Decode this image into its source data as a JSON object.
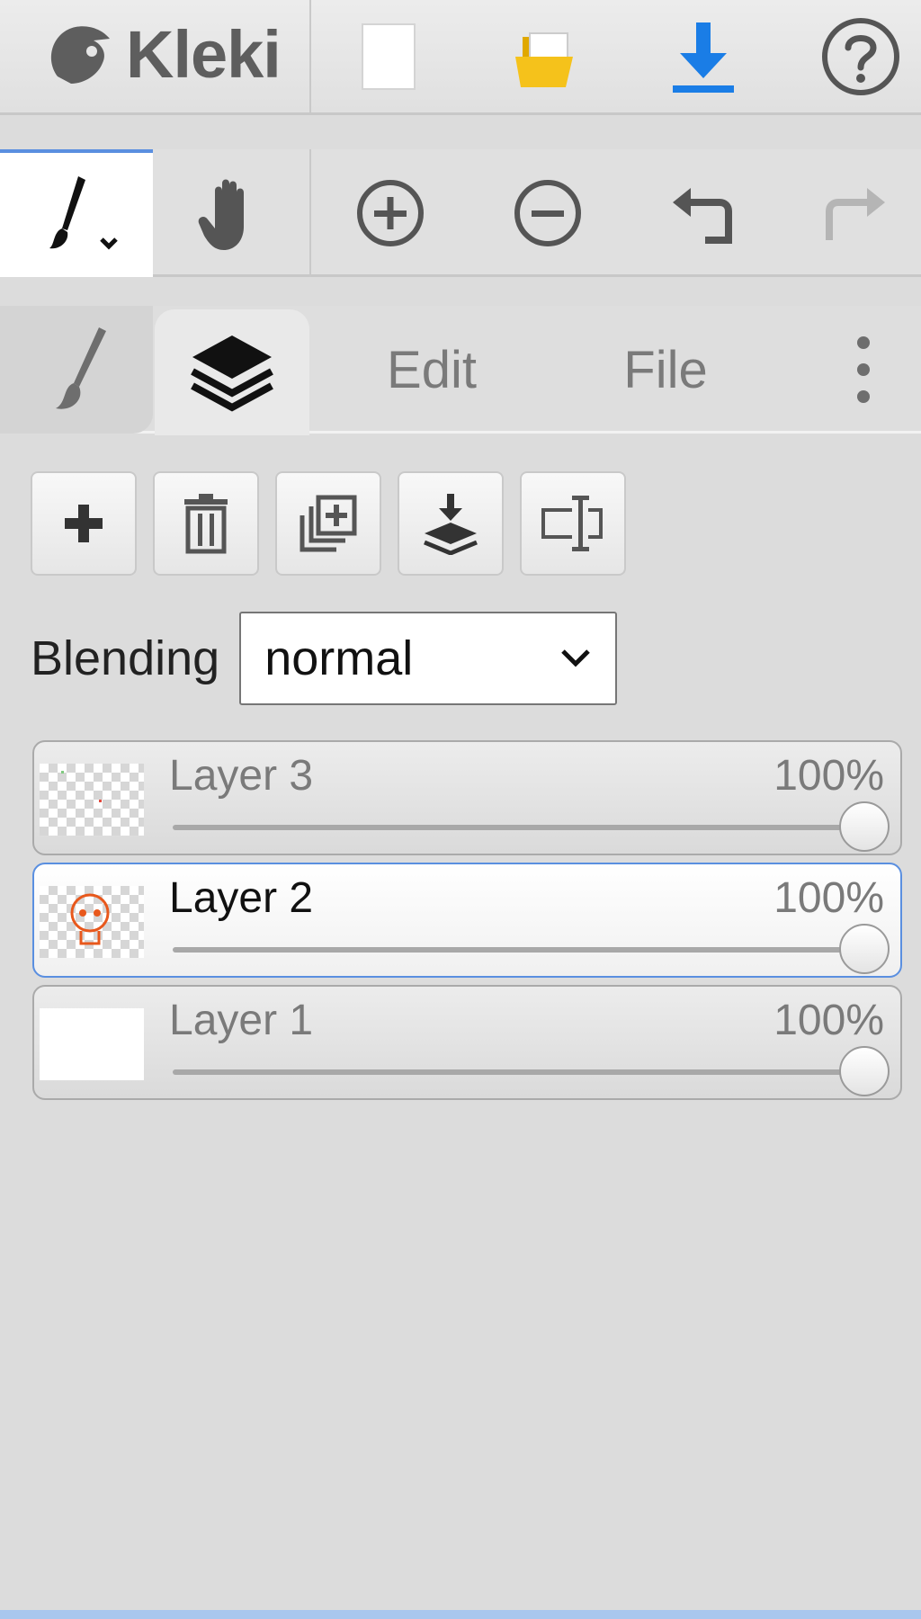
{
  "app": {
    "logo_text": "Kleki"
  },
  "topbar": {
    "new_icon": "new-document-icon",
    "open_icon": "open-folder-icon",
    "save_icon": "download-icon",
    "help_icon": "help-icon"
  },
  "tools": {
    "brush_icon": "brush-icon",
    "hand_icon": "hand-icon",
    "zoom_in_icon": "zoom-in-icon",
    "zoom_out_icon": "zoom-out-icon",
    "undo_icon": "undo-icon",
    "redo_icon": "redo-icon"
  },
  "tabs": [
    {
      "icon": "brush-icon"
    },
    {
      "icon": "layers-icon"
    },
    {
      "label": "Edit"
    },
    {
      "label": "File"
    },
    {
      "icon": "more-vertical-icon"
    }
  ],
  "layer_panel": {
    "actions": [
      "add-layer",
      "delete-layer",
      "duplicate-layer",
      "merge-down",
      "rename-layer"
    ],
    "blending_label": "Blending",
    "blending_value": "normal",
    "layers": [
      {
        "name": "Layer 3",
        "opacity_label": "100%",
        "opacity": 1.0,
        "selected": false
      },
      {
        "name": "Layer 2",
        "opacity_label": "100%",
        "opacity": 1.0,
        "selected": true
      },
      {
        "name": "Layer 1",
        "opacity_label": "100%",
        "opacity": 1.0,
        "selected": false
      }
    ]
  },
  "colors": {
    "accent": "#5a8fe0",
    "download": "#1a7de6",
    "folder": "#f5c21b"
  }
}
